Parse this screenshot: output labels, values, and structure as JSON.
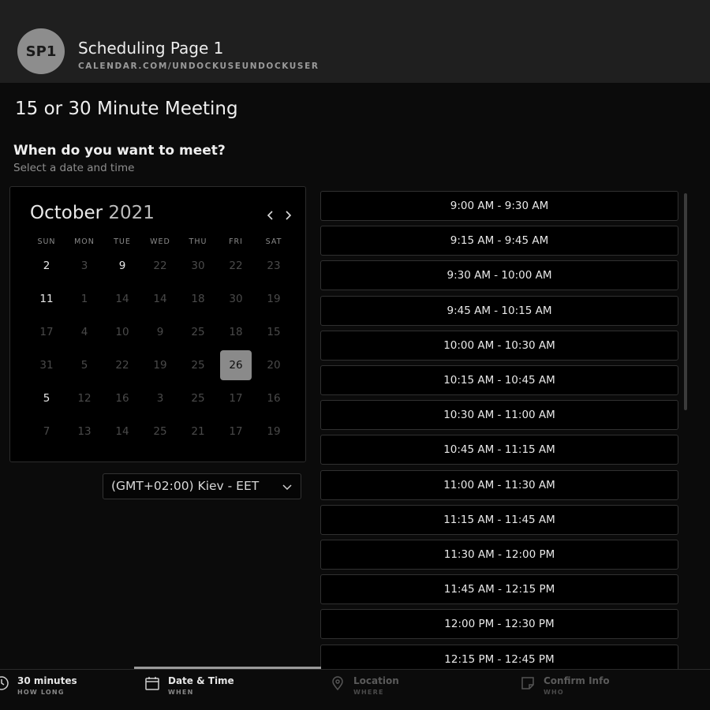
{
  "header": {
    "avatar_initials": "SP1",
    "page_name": "Scheduling Page 1",
    "page_url": "CALENDAR.COM/UNDOCKUSEUNDOCKUSER"
  },
  "meeting_title": "15 or 30 Minute Meeting",
  "section": {
    "title": "When do you want to meet?",
    "subtitle": "Select a date and time"
  },
  "calendar": {
    "month": "October",
    "year": "2021",
    "prev_icon": "chevron-left-icon",
    "next_icon": "chevron-right-icon",
    "weekdays": [
      "SUN",
      "MON",
      "TUE",
      "WED",
      "THU",
      "FRI",
      "SAT"
    ],
    "weeks": [
      [
        {
          "d": "2",
          "s": "avail"
        },
        {
          "d": "3",
          "s": "off"
        },
        {
          "d": "9",
          "s": "avail"
        },
        {
          "d": "22",
          "s": "off"
        },
        {
          "d": "30",
          "s": "off"
        },
        {
          "d": "22",
          "s": "off"
        },
        {
          "d": "23",
          "s": "off"
        }
      ],
      [
        {
          "d": "11",
          "s": "avail"
        },
        {
          "d": "1",
          "s": "off"
        },
        {
          "d": "14",
          "s": "off"
        },
        {
          "d": "14",
          "s": "off"
        },
        {
          "d": "18",
          "s": "off"
        },
        {
          "d": "30",
          "s": "off"
        },
        {
          "d": "19",
          "s": "off"
        }
      ],
      [
        {
          "d": "17",
          "s": "off"
        },
        {
          "d": "4",
          "s": "off"
        },
        {
          "d": "10",
          "s": "off"
        },
        {
          "d": "9",
          "s": "off"
        },
        {
          "d": "25",
          "s": "off"
        },
        {
          "d": "18",
          "s": "off"
        },
        {
          "d": "15",
          "s": "off"
        }
      ],
      [
        {
          "d": "31",
          "s": "off"
        },
        {
          "d": "5",
          "s": "off"
        },
        {
          "d": "22",
          "s": "off"
        },
        {
          "d": "19",
          "s": "off"
        },
        {
          "d": "25",
          "s": "off"
        },
        {
          "d": "26",
          "s": "selected"
        },
        {
          "d": "20",
          "s": "off"
        }
      ],
      [
        {
          "d": "5",
          "s": "avail"
        },
        {
          "d": "12",
          "s": "off"
        },
        {
          "d": "16",
          "s": "off"
        },
        {
          "d": "3",
          "s": "off"
        },
        {
          "d": "25",
          "s": "off"
        },
        {
          "d": "17",
          "s": "off"
        },
        {
          "d": "16",
          "s": "off"
        }
      ],
      [
        {
          "d": "7",
          "s": "off"
        },
        {
          "d": "13",
          "s": "off"
        },
        {
          "d": "14",
          "s": "off"
        },
        {
          "d": "25",
          "s": "off"
        },
        {
          "d": "21",
          "s": "off"
        },
        {
          "d": "17",
          "s": "off"
        },
        {
          "d": "19",
          "s": "off"
        }
      ]
    ]
  },
  "timezone": {
    "value": "(GMT+02:00) Kiev - EET",
    "icon": "chevron-down-icon"
  },
  "slots": [
    "9:00 AM - 9:30 AM",
    "9:15 AM - 9:45 AM",
    "9:30 AM - 10:00 AM",
    "9:45 AM - 10:15 AM",
    "10:00 AM - 10:30 AM",
    "10:15 AM - 10:45 AM",
    "10:30 AM - 11:00 AM",
    "10:45 AM - 11:15 AM",
    "11:00 AM - 11:30 AM",
    "11:15 AM - 11:45 AM",
    "11:30 AM - 12:00 PM",
    "11:45 AM - 12:15 PM",
    "12:00 PM - 12:30 PM",
    "12:15 PM - 12:45 PM"
  ],
  "steps": [
    {
      "label": "30 minutes",
      "sub": "HOW LONG",
      "icon": "clock-icon",
      "active": false
    },
    {
      "label": "Date & Time",
      "sub": "WHEN",
      "icon": "calendar-icon",
      "active": true
    },
    {
      "label": "Location",
      "sub": "WHERE",
      "icon": "location-pin-icon",
      "active": false
    },
    {
      "label": "Confirm Info",
      "sub": "WHO",
      "icon": "note-icon",
      "active": false
    }
  ]
}
